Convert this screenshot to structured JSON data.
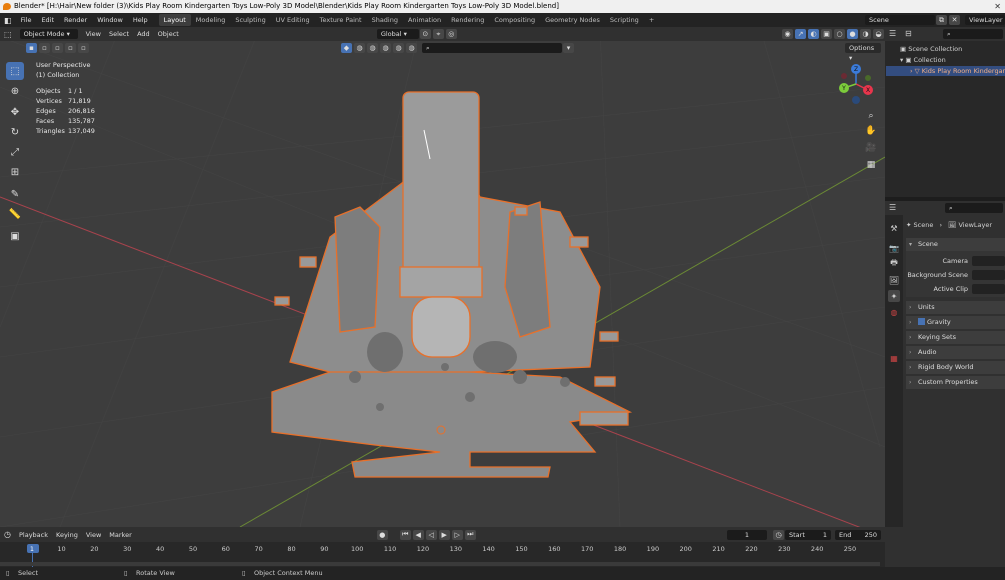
{
  "window": {
    "title": "Blender* [H:\\Hair\\New folder (3)\\Kids Play Room Kindergarten Toys Low-Poly 3D Model\\Blender\\Kids Play Room Kindergarten Toys Low-Poly 3D Model.blend]"
  },
  "menu": [
    "File",
    "Edit",
    "Render",
    "Window",
    "Help"
  ],
  "workspaces": [
    {
      "label": "Layout",
      "active": true
    },
    {
      "label": "Modeling"
    },
    {
      "label": "Sculpting"
    },
    {
      "label": "UV Editing"
    },
    {
      "label": "Texture Paint"
    },
    {
      "label": "Shading"
    },
    {
      "label": "Animation"
    },
    {
      "label": "Rendering"
    },
    {
      "label": "Compositing"
    },
    {
      "label": "Geometry Nodes"
    },
    {
      "label": "Scripting"
    }
  ],
  "scene_selector": {
    "scene": "Scene",
    "view_layer": "ViewLayer"
  },
  "viewport_header": {
    "mode": "Object Mode",
    "menus": [
      "View",
      "Select",
      "Add",
      "Object"
    ],
    "orientation": "Global",
    "options": "Options"
  },
  "overlay": {
    "view_name": "User Perspective",
    "collection": "(1) Collection",
    "stats": [
      {
        "k": "Objects",
        "v": "1 / 1"
      },
      {
        "k": "Vertices",
        "v": "71,819"
      },
      {
        "k": "Edges",
        "v": "206,816"
      },
      {
        "k": "Faces",
        "v": "135,787"
      },
      {
        "k": "Triangles",
        "v": "137,049"
      }
    ]
  },
  "gizmo": {
    "x": "X",
    "y": "Y",
    "z": "Z",
    "colors": {
      "x": "#e8354c",
      "y": "#7ccb3b",
      "z": "#3b7bd9"
    }
  },
  "outliner": {
    "root": "Scene Collection",
    "collection": "Collection",
    "object": "Kids Play Room Kindergart"
  },
  "properties": {
    "breadcrumb": {
      "scene": "Scene",
      "layer": "ViewLayer"
    },
    "section": "Scene",
    "labels": {
      "camera": "Camera",
      "background_scene": "Background Scene",
      "active_clip": "Active Clip"
    },
    "panels": [
      "Units",
      "Gravity",
      "Keying Sets",
      "Audio",
      "Rigid Body World",
      "Custom Properties"
    ]
  },
  "timeline": {
    "menus": [
      "Playback",
      "Keying",
      "View",
      "Marker"
    ],
    "current_frame": "1",
    "start_label": "Start",
    "start": "1",
    "end_label": "End",
    "end": "250",
    "ticks": [
      "1",
      "10",
      "20",
      "30",
      "40",
      "50",
      "60",
      "70",
      "80",
      "90",
      "100",
      "110",
      "120",
      "130",
      "140",
      "150",
      "160",
      "170",
      "180",
      "190",
      "200",
      "210",
      "220",
      "230",
      "240",
      "250"
    ]
  },
  "statusbar": {
    "select": "Select",
    "rotate": "Rotate View",
    "context": "Object Context Menu"
  },
  "colors": {
    "accent": "#4772b3",
    "selection": "#e8702a",
    "viewport_bg": "#3d3d3d"
  }
}
